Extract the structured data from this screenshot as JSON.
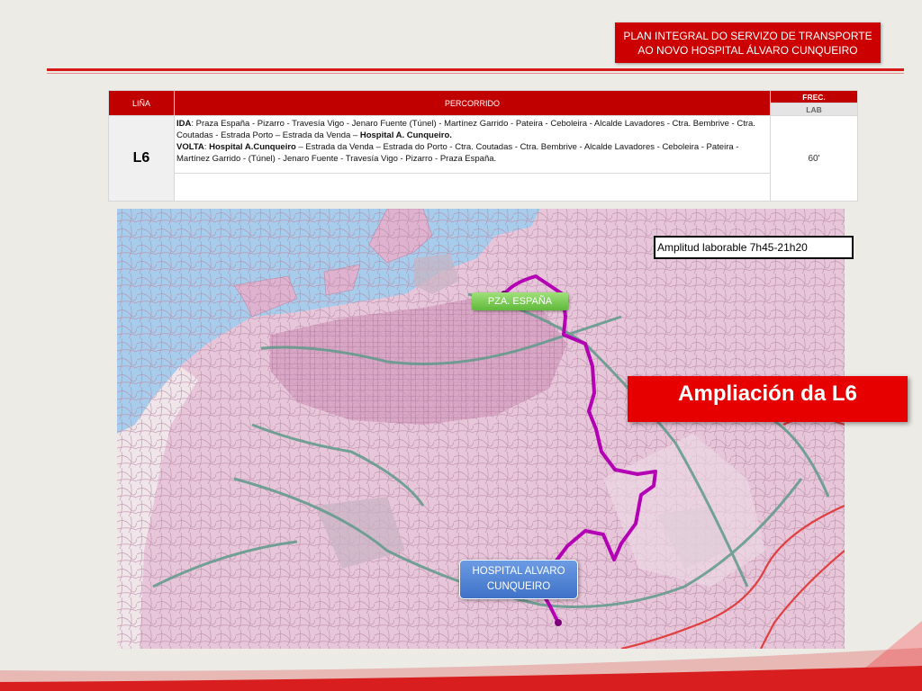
{
  "header": {
    "line1": "PLAN INTEGRAL DO SERVIZO  DE TRANSPORTE",
    "line2": "AO NOVO HOSPITAL ÁLVARO CUNQUEIRO"
  },
  "table": {
    "col_line": "LIÑA",
    "col_route": "PERCORRIDO",
    "col_freq": "FREC.",
    "col_freq_sub": "LAB",
    "line_id": "L6",
    "ida_label": "IDA",
    "ida_text": ": Praza España - Pizarro - Travesía Vigo - Jenaro Fuente (Túnel) - Martínez Garrido - Pateira - Ceboleira - Alcalde Lavadores - Ctra. Bembrive - Ctra. Coutadas -  Estrada Porto – Estrada da Venda – ",
    "ida_end": "Hospital A. Cunqueiro.",
    "volta_label": "VOLTA",
    "volta_sep": ": ",
    "volta_start": "Hospital A.Cunqueiro",
    "volta_text": " – Estrada da Venda – Estrada do Porto - Ctra. Coutadas - Ctra. Bembrive - Alcalde Lavadores - Ceboleira - Pateira - Martínez Garrido - (Túnel) - Jenaro Fuente - Travesía Vigo - Pizarro - Praza España.",
    "frequency": "60'"
  },
  "map": {
    "schedule_note": "Amplitud laborable  7h45-21h20",
    "title": "Ampliación da L6",
    "stop_start": "PZA. ESPAÑA",
    "stop_end_line1": "HOSPITAL ALVARO",
    "stop_end_line2": "CUNQUEIRO",
    "route_color": "#b400b4",
    "sea_color": "#a8cdec",
    "urban_color": "#dfb3cf"
  }
}
